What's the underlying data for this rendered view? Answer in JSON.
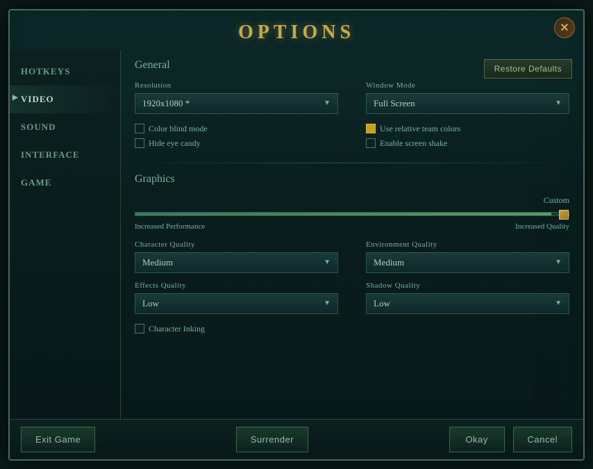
{
  "modal": {
    "title": "OPTIONS",
    "close_label": "✕"
  },
  "sidebar": {
    "items": [
      {
        "id": "hotkeys",
        "label": "HOTKEYS",
        "active": false
      },
      {
        "id": "video",
        "label": "VIDEO",
        "active": true
      },
      {
        "id": "sound",
        "label": "SOUND",
        "active": false
      },
      {
        "id": "interface",
        "label": "INTERFACE",
        "active": false
      },
      {
        "id": "game",
        "label": "GAME",
        "active": false
      }
    ]
  },
  "content": {
    "restore_defaults": "Restore Defaults",
    "general": {
      "section_title": "General",
      "resolution_label": "Resolution",
      "resolution_value": "1920x1080 *",
      "window_mode_label": "Window Mode",
      "window_mode_value": "Full Screen",
      "checkboxes": [
        {
          "id": "color_blind",
          "label": "Color blind mode",
          "checked": false
        },
        {
          "id": "relative_colors",
          "label": "Use relative team colors",
          "checked": true
        },
        {
          "id": "hide_candy",
          "label": "Hide eye candy",
          "checked": false
        },
        {
          "id": "screen_shake",
          "label": "Enable screen shake",
          "checked": false
        }
      ]
    },
    "graphics": {
      "section_title": "Graphics",
      "quality_label": "Custom",
      "slider_left": "Increased Performance",
      "slider_right": "Increased Quality",
      "slider_value": 96,
      "dropdowns": [
        {
          "id": "char_quality",
          "label": "Character Quality",
          "value": "Medium"
        },
        {
          "id": "env_quality",
          "label": "Environment Quality",
          "value": "Medium"
        },
        {
          "id": "effects_quality",
          "label": "Effects Quality",
          "value": "Low"
        },
        {
          "id": "shadow_quality",
          "label": "Shadow Quality",
          "value": "Low"
        }
      ],
      "char_inking_label": "Character Inking",
      "char_inking_checked": false
    }
  },
  "footer": {
    "exit_game": "Exit Game",
    "surrender": "Surrender",
    "okay": "Okay",
    "cancel": "Cancel"
  }
}
